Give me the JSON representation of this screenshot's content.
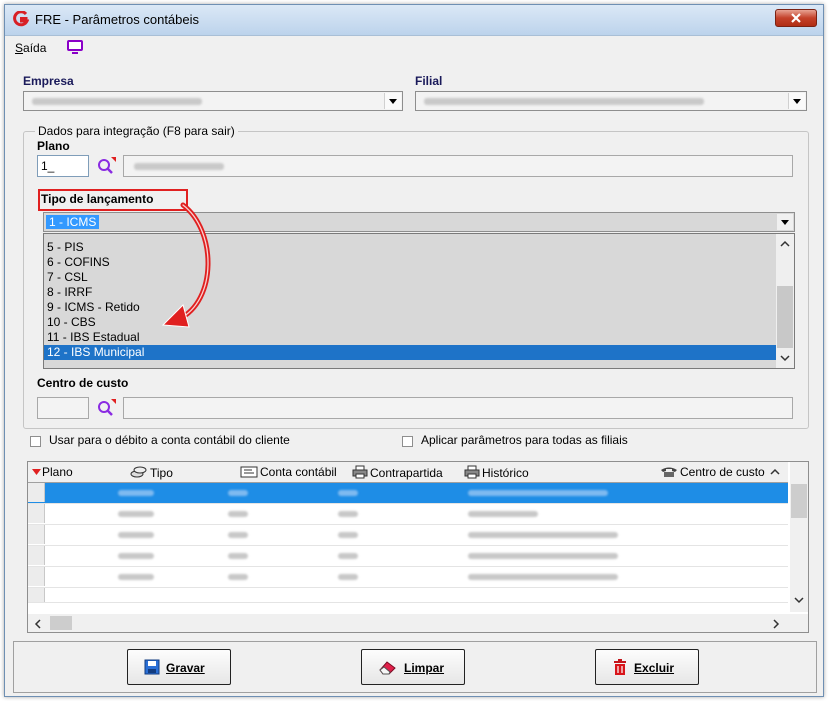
{
  "window": {
    "title": "FRE - Parâmetros contábeis"
  },
  "menu": {
    "saida_first": "S",
    "saida_rest": "aída"
  },
  "empresa": {
    "label": "Empresa"
  },
  "filial": {
    "label": "Filial"
  },
  "group": {
    "title": "Dados para integração  (F8 para sair)"
  },
  "plano": {
    "label": "Plano",
    "value": "1_"
  },
  "tipo": {
    "label": "Tipo de lançamento",
    "selected": "1 - ICMS",
    "options": [
      "5 - PIS",
      "6 - COFINS",
      "7 - CSL",
      "8 - IRRF",
      "9 - ICMS - Retido",
      "10 - CBS",
      "11 - IBS Estadual",
      "12 - IBS Municipal"
    ],
    "highlighted_index": 7
  },
  "centro": {
    "label": "Centro de custo"
  },
  "checks": {
    "debito": "Usar para o débito a conta contábil do cliente",
    "aplicar": "Aplicar parâmetros para todas as filiais"
  },
  "grid": {
    "columns": {
      "plano": "Plano",
      "tipo": "Tipo",
      "conta": "Conta contábil",
      "contrapartida": "Contrapartida",
      "historico": "Histórico",
      "centro": "Centro de custo"
    }
  },
  "buttons": {
    "gravar_first": "G",
    "gravar_rest": "ravar",
    "limpar_first": "L",
    "limpar_rest": "impar",
    "excluir_first": "E",
    "excluir_rest": "xcluir"
  },
  "colors": {
    "accent": "#1e73c8",
    "highlight_box": "#e02020"
  }
}
